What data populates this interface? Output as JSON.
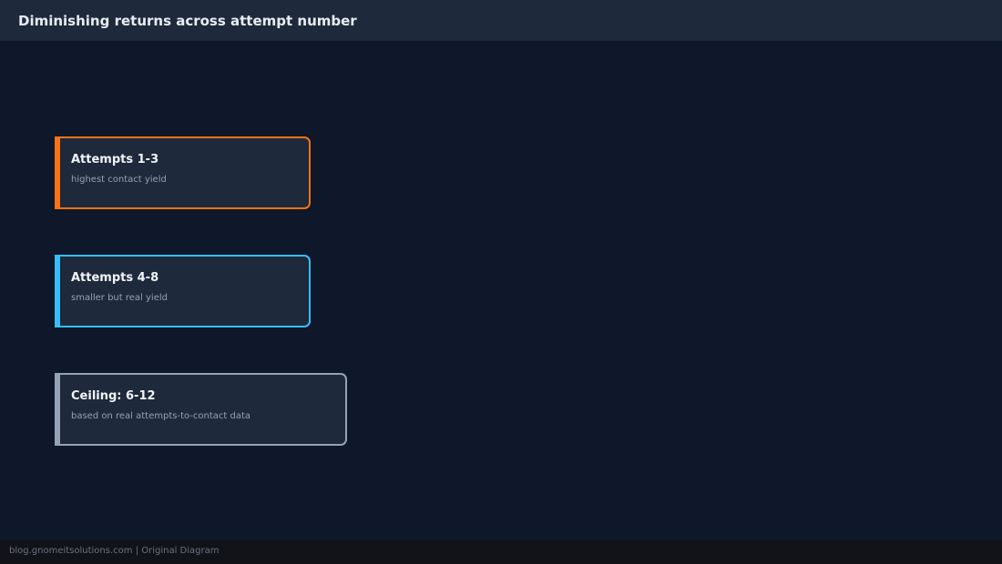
{
  "header": {
    "title": "Diminishing returns across attempt number"
  },
  "cards": [
    {
      "title": "Attempts 1-3",
      "subtitle": "highest contact yield",
      "accent": "#f97316"
    },
    {
      "title": "Attempts 4-8",
      "subtitle": "smaller but real yield",
      "accent": "#38bdf8"
    },
    {
      "title": "Ceiling: 6-12",
      "subtitle": "based on real attempts-to-contact data",
      "accent": "#94a3b8"
    }
  ],
  "footer": {
    "text": "blog.gnomeitsolutions.com | Original Diagram"
  },
  "colors": {
    "background": "#0f172a",
    "header_background": "#1e293b",
    "card_background": "#1e293b",
    "footer_background": "#111318"
  }
}
